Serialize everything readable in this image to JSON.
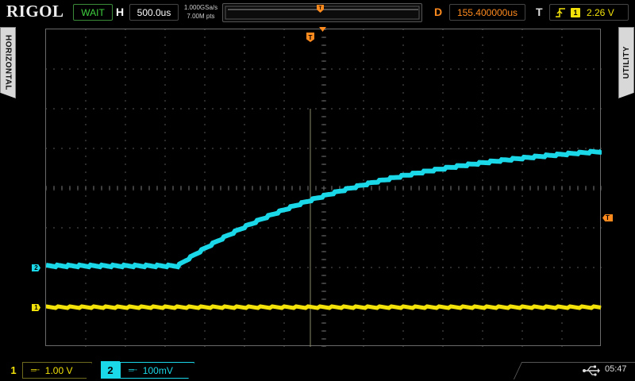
{
  "brand": "RIGOL",
  "status": "WAIT",
  "horizontal": {
    "label": "H",
    "timebase": "500.0us",
    "sample_rate": "1.000GSa/s",
    "memory_depth": "7.00M pts"
  },
  "delay": {
    "label": "D",
    "value": "155.400000us"
  },
  "trigger": {
    "label": "T",
    "source": "1",
    "level": "2.26 V",
    "edge_icon": "rising-edge-icon"
  },
  "side_tabs": {
    "left": "HORIZONTAL",
    "right": "UTILITY"
  },
  "markers": {
    "ch1": "1",
    "ch2": "2",
    "trigger": "T"
  },
  "channels": [
    {
      "number": "1",
      "coupling": "DC",
      "scale": "1.00 V",
      "color": "#f2e20a"
    },
    {
      "number": "2",
      "coupling": "DC",
      "scale": "100mV",
      "color": "#1ad8e8"
    }
  ],
  "clock": "05:47",
  "colors": {
    "ch1": "#f2e20a",
    "ch2": "#1ad8e8",
    "trigger": "#ff8a1e",
    "status": "#3fd33f"
  }
}
